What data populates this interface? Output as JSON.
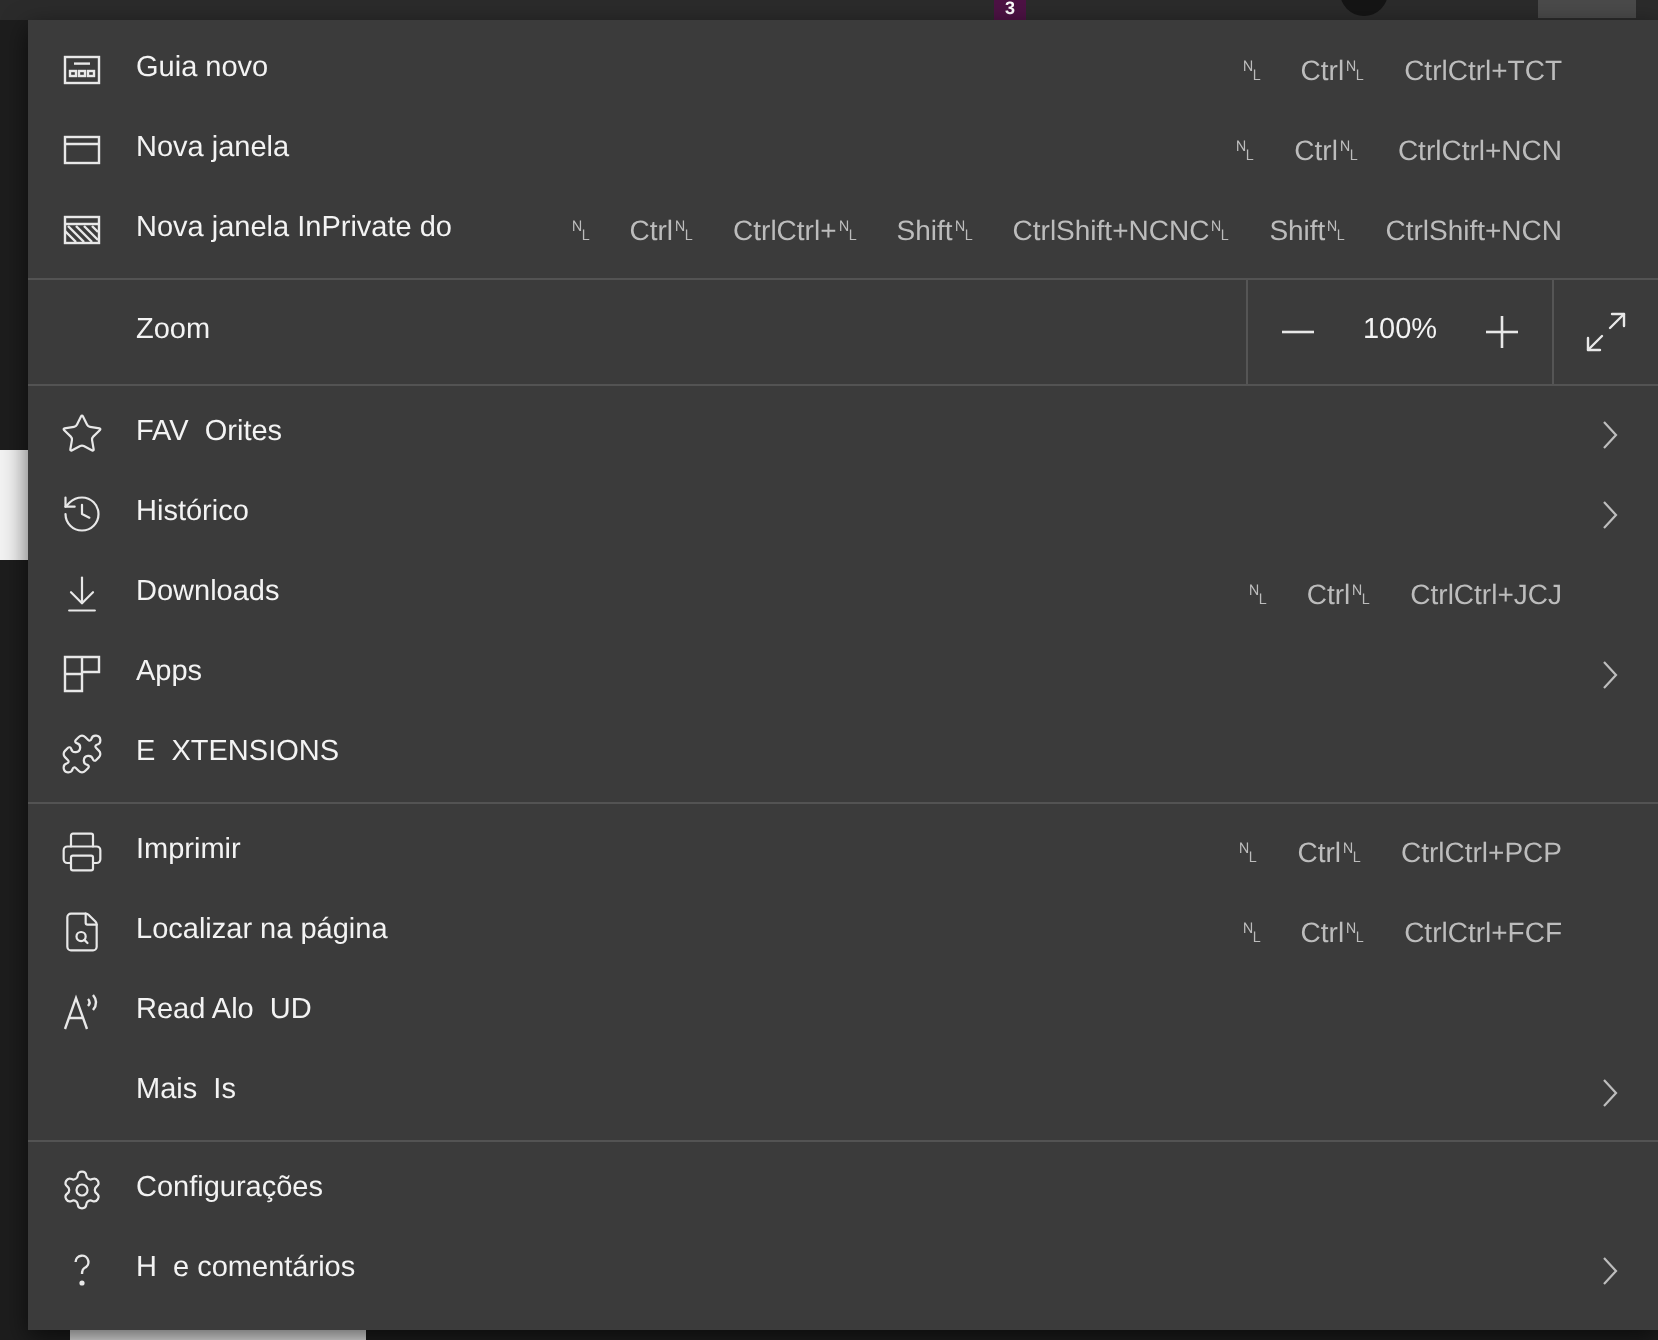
{
  "top_bar": {
    "notification_badge": "3"
  },
  "menu": {
    "sections": [
      {
        "items": [
          {
            "kind": "item",
            "label": "Guia novo",
            "shortcut": [
              "␤",
              "Ctrl␤",
              "CtrlCtrl+TCT"
            ],
            "submenu": false
          },
          {
            "kind": "item",
            "label": "Nova janela",
            "shortcut": [
              "␤",
              "Ctrl␤",
              "CtrlCtrl+NCN"
            ],
            "submenu": false
          },
          {
            "kind": "item",
            "label": "Nova janela InPrivate do",
            "shortcut": [
              "␤",
              "Ctrl␤",
              "CtrlCtrl+␤",
              "Shift␤",
              "CtrlShift+NCNC␤",
              "Shift␤",
              "CtrlShift+NCN"
            ],
            "submenu": false
          }
        ]
      },
      {
        "items": [
          {
            "kind": "zoom",
            "label": "Zoom",
            "value": "100%"
          }
        ]
      },
      {
        "items": [
          {
            "kind": "item",
            "label": "FAV  Orites",
            "submenu": true
          },
          {
            "kind": "item",
            "label": "Histórico",
            "submenu": true
          },
          {
            "kind": "item",
            "label": "Downloads",
            "shortcut": [
              "␤",
              "Ctrl␤",
              "CtrlCtrl+JCJ"
            ],
            "submenu": false
          },
          {
            "kind": "item",
            "label": "Apps",
            "submenu": true
          },
          {
            "kind": "item",
            "label": "E  XTENSIONS",
            "submenu": false
          }
        ]
      },
      {
        "items": [
          {
            "kind": "item",
            "label": "Imprimir",
            "shortcut": [
              "␤",
              "Ctrl␤",
              "CtrlCtrl+PCP"
            ],
            "submenu": false
          },
          {
            "kind": "item",
            "label": "Localizar na página",
            "shortcut": [
              "␤",
              "Ctrl␤",
              "CtrlCtrl+FCF"
            ],
            "submenu": false
          },
          {
            "kind": "item",
            "label": "Read Alo  UD",
            "submenu": false
          },
          {
            "kind": "item",
            "label": "Mais  Is",
            "submenu": true
          }
        ]
      },
      {
        "items": [
          {
            "kind": "item",
            "label": "Configurações",
            "submenu": false
          },
          {
            "kind": "item",
            "label": "H  e comentários",
            "submenu": true
          }
        ]
      }
    ]
  }
}
